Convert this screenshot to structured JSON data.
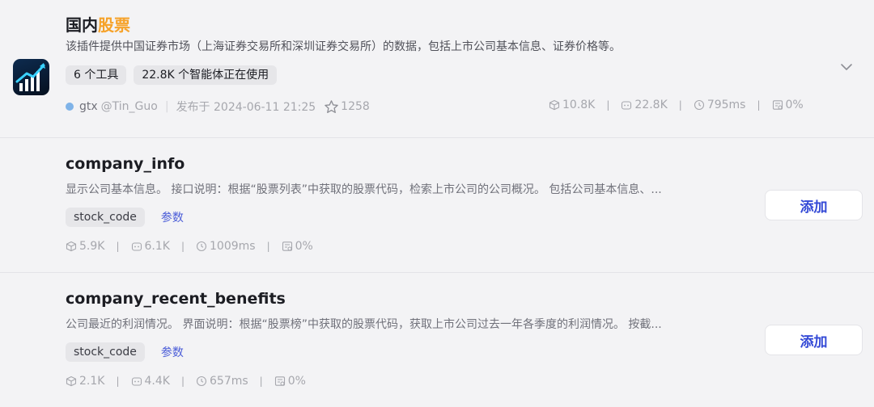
{
  "plugin": {
    "title_main": "国内",
    "title_highlight": "股票",
    "description": "该插件提供中国证券市场（上海证券交易所和深圳证券交易所）的数据，包括上市公司基本信息、证券价格等。",
    "tags": [
      "6 个工具",
      "22.8K 个智能体正在使用"
    ],
    "author_name": "gtx",
    "author_handle": "@Tin_Guo",
    "published": "发布于 2024-06-11 21:25",
    "favorites": "1258",
    "stats": {
      "calls": "10.8K",
      "bots": "22.8K",
      "latency": "795ms",
      "error_rate": "0%"
    }
  },
  "tools": [
    {
      "name": "company_info",
      "description": "显示公司基本信息。 接口说明：根据“股票列表”中获取的股票代码，检索上市公司的公司概况。 包括公司基本信息、...",
      "param": "stock_code",
      "param_link": "参数",
      "stats": {
        "calls": "5.9K",
        "bots": "6.1K",
        "latency": "1009ms",
        "error_rate": "0%"
      },
      "add_label": "添加"
    },
    {
      "name": "company_recent_benefits",
      "description": "公司最近的利润情况。 界面说明：根据“股票榜”中获取的股票代码，获取上市公司过去一年各季度的利润情况。 按截...",
      "param": "stock_code",
      "param_link": "参数",
      "stats": {
        "calls": "2.1K",
        "bots": "4.4K",
        "latency": "657ms",
        "error_rate": "0%"
      },
      "add_label": "添加"
    }
  ],
  "colors": {
    "accent": "#3349d6",
    "highlight": "#f6a229",
    "background": "#f3f3f5"
  },
  "icons": [
    "chart-logo-icon",
    "star-icon",
    "cube-icon",
    "bot-icon",
    "clock-icon",
    "error-doc-icon",
    "chevron-down-icon"
  ]
}
